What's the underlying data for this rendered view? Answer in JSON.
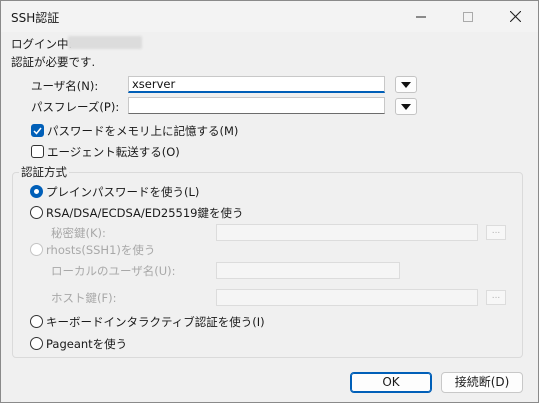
{
  "window": {
    "title": "SSH認証"
  },
  "status": {
    "login_label": "ログイン中:",
    "auth_required": "認証が必要です."
  },
  "form": {
    "username_label": "ユーザ名(N):",
    "username_value": "xserver",
    "passphrase_label": "パスフレーズ(P):",
    "passphrase_value": "",
    "remember_label": "パスワードをメモリ上に記憶する(M)",
    "remember_checked": true,
    "agent_forward_label": "エージェント転送する(O)",
    "agent_forward_checked": false
  },
  "auth": {
    "group_label": "認証方式",
    "option_password": "プレインパスワードを使う(L)",
    "option_rsa": "RSA/DSA/ECDSA/ED25519鍵を使う",
    "private_key_label": "秘密鍵(K):",
    "option_rhosts": "rhosts(SSH1)を使う",
    "local_user_label": "ローカルのユーザ名(U):",
    "host_key_label": "ホスト鍵(F):",
    "option_keyboard": "キーボードインタラクティブ認証を使う(I)",
    "option_pageant": "Pageantを使う",
    "browse_label": "...",
    "selected": "password"
  },
  "buttons": {
    "ok": "OK",
    "disconnect": "接続断(D)"
  },
  "colors": {
    "accent": "#005fb8"
  }
}
